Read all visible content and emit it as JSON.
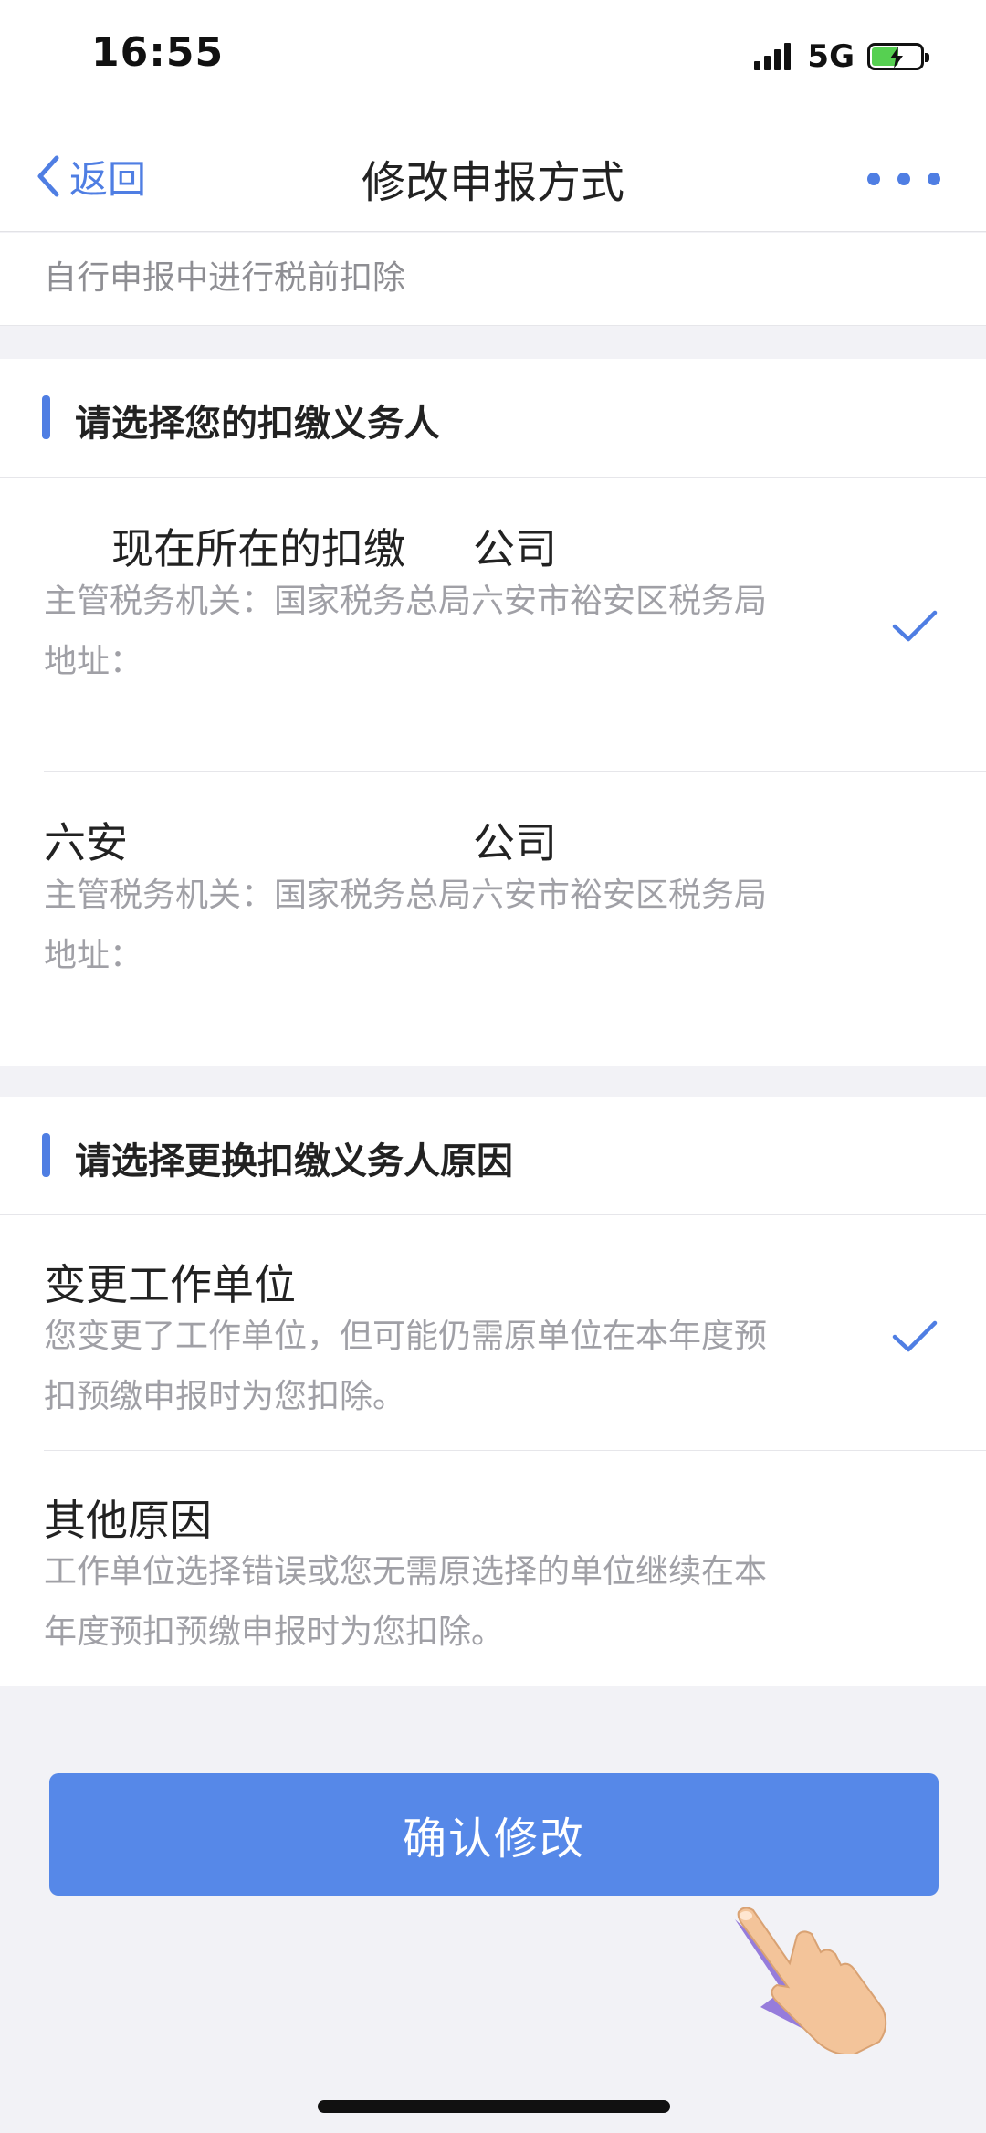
{
  "status_bar": {
    "time": "16:55",
    "network": "5G"
  },
  "nav": {
    "back_label": "返回",
    "title": "修改申报方式"
  },
  "top_note": "自行申报中进行税前扣除",
  "withholding_section": {
    "title": "请选择您的扣缴义务人",
    "options": [
      {
        "name_prefix": "现在所在的扣缴",
        "name_suffix": "公司",
        "authority": "主管税务机关：国家税务总局六安市裕安区税务局",
        "address": "地址：",
        "selected": true
      },
      {
        "name_prefix": "六安",
        "name_suffix": "公司",
        "authority": "主管税务机关：国家税务总局六安市裕安区税务局",
        "address": "地址：",
        "selected": false
      }
    ]
  },
  "reason_section": {
    "title": "请选择更换扣缴义务人原因",
    "options": [
      {
        "name": "变更工作单位",
        "desc_line1": "您变更了工作单位，但可能仍需原单位在本年度预",
        "desc_line2": "扣预缴申报时为您扣除。",
        "selected": true
      },
      {
        "name": "其他原因",
        "desc_line1": "工作单位选择错误或您无需原选择的单位继续在本",
        "desc_line2": "年度预扣预缴申报时为您扣除。",
        "selected": false
      }
    ]
  },
  "confirm_label": "确认修改",
  "colors": {
    "accent": "#4f7ee3",
    "button": "#5688e8",
    "background": "#f2f2f6"
  }
}
